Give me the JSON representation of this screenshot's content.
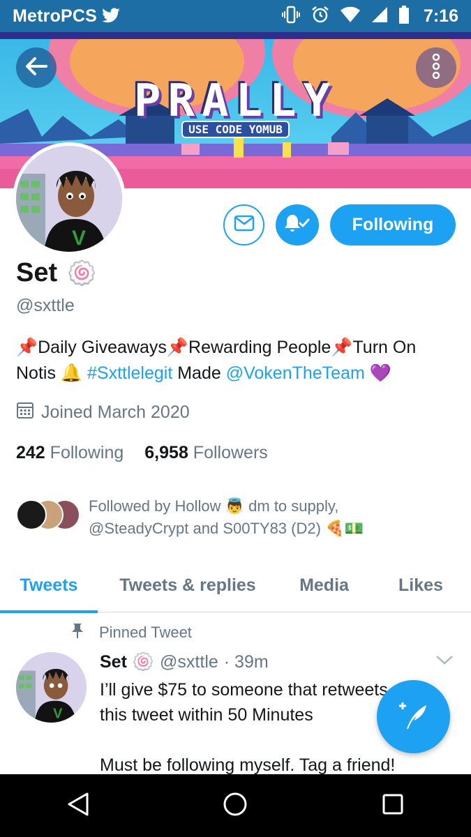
{
  "status_bar": {
    "carrier": "MetroPCS",
    "time": "7:16",
    "icons": [
      "twitter-bird-icon",
      "vibrate-icon",
      "alarm-icon",
      "wifi-icon",
      "signal-icon",
      "battery-icon"
    ]
  },
  "banner": {
    "title": "PRALLY",
    "code_text": "USE CODE YOMUB"
  },
  "header_actions": {
    "back_icon": "arrow-back-icon",
    "more_icon": "more-vertical-icon"
  },
  "actions": {
    "message_icon": "mail-icon",
    "notifications_icon": "bell-check-icon",
    "follow_label": "Following"
  },
  "profile": {
    "name": "Set",
    "name_emoji": "🍥",
    "handle": "@sxttle",
    "bio": {
      "line1": "📌Daily Giveaways📌Rewarding People📌Turn On",
      "line2_a": "Notis 🔔 ",
      "hashtag": "#Sxttlelegit",
      "line2_b": " Made ",
      "mention": "@VokenTheTeam",
      "line2_c": " 💜"
    },
    "joined": "Joined March 2020",
    "following_count": "242",
    "following_label": "Following",
    "followers_count": "6,958",
    "followers_label": "Followers",
    "followed_by_line1": "Followed by Hollow 👼 dm to supply,",
    "followed_by_line2": "@SteadyCrypt and S00TY83 (D2) 🍕💵"
  },
  "tabs": [
    {
      "label": "Tweets",
      "active": true
    },
    {
      "label": "Tweets & replies",
      "active": false
    },
    {
      "label": "Media",
      "active": false
    },
    {
      "label": "Likes",
      "active": false
    }
  ],
  "tweet": {
    "pinned_label": "Pinned Tweet",
    "name": "Set",
    "name_emoji": "🍥",
    "handle": "@sxttle",
    "time": "· 39m",
    "text": "I’ll give $75 to someone that retweets\nthis tweet within 50 Minutes\n\nMust be following myself. Tag a friend!"
  },
  "colors": {
    "accent": "#1da1f2",
    "status_bar": "#1c6ea4",
    "secondary_text": "#657786"
  }
}
